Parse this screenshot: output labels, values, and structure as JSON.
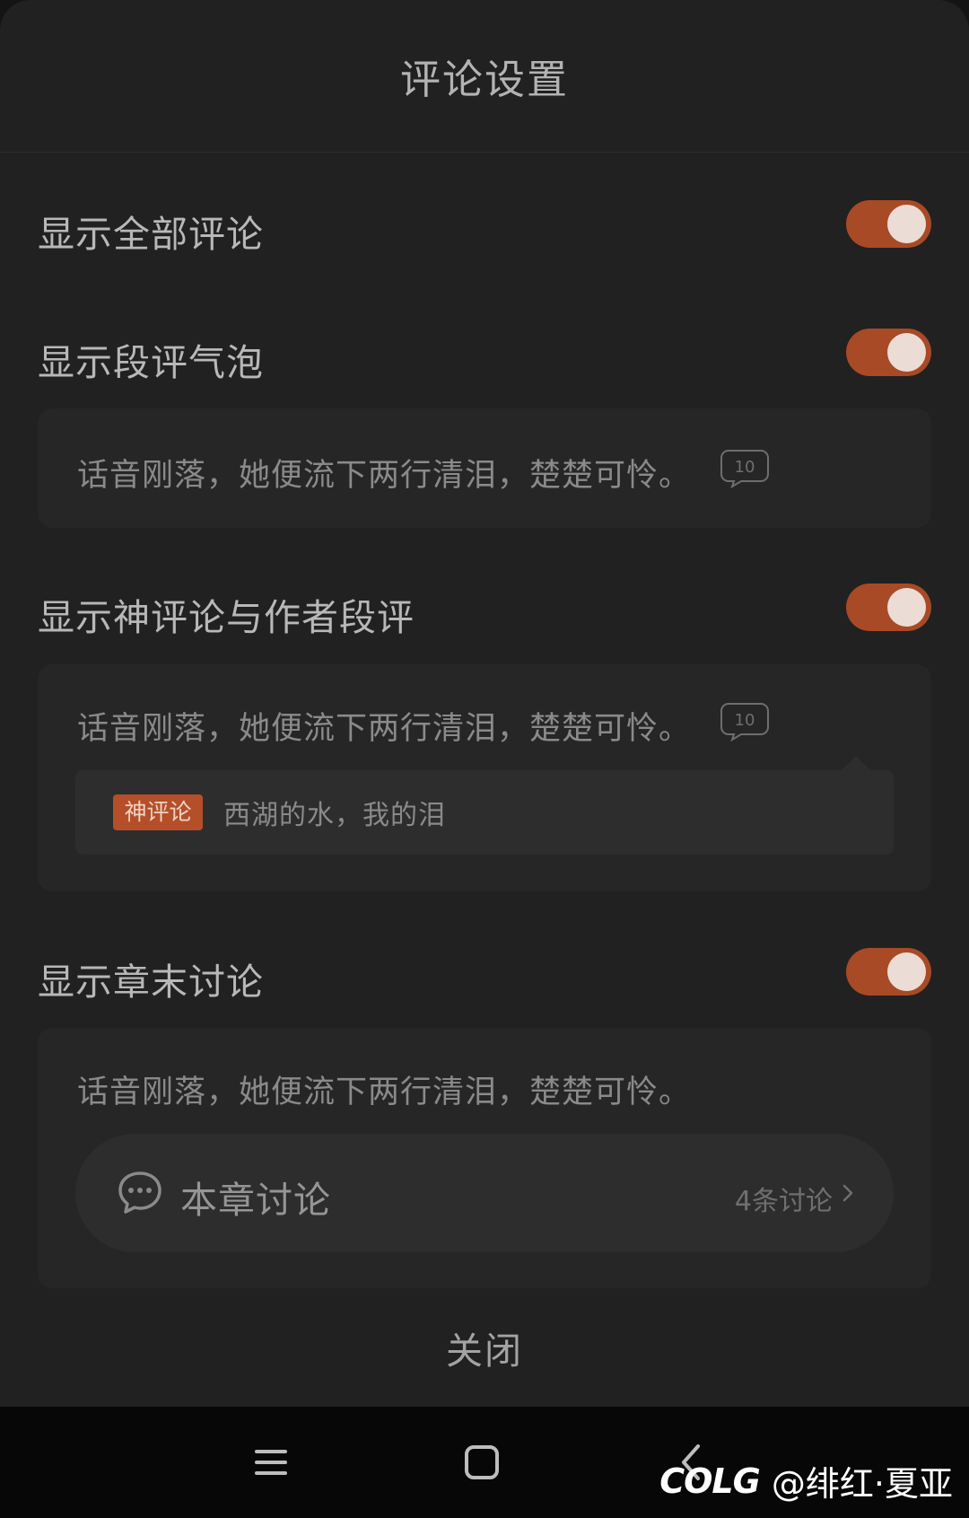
{
  "sheet": {
    "title": "评论设置",
    "close_label": "关闭"
  },
  "settings": [
    {
      "label": "显示全部评论",
      "enabled": true
    },
    {
      "label": "显示段评气泡",
      "enabled": true
    },
    {
      "label": "显示神评论与作者段评",
      "enabled": true
    },
    {
      "label": "显示章末讨论",
      "enabled": true
    }
  ],
  "previews": {
    "sample_sentence": "话音刚落，她便流下两行清泪，楚楚可怜。",
    "bubble_count": "10",
    "god_comment_tag": "神评论",
    "god_comment_text": "西湖的水，我的泪",
    "chapter_discussion_label": "本章讨论",
    "chapter_discussion_count": "4条讨论"
  },
  "colors": {
    "toggle_on": "#a84a26",
    "tag_background": "#b44f2a",
    "sheet_background": "#212121"
  },
  "icons": {
    "bubble": "comment-bubble-icon",
    "discussion": "chat-bubble-icon",
    "chevron": "chevron-right-icon",
    "nav_menu": "menu-icon",
    "nav_home": "home-square-icon",
    "nav_back": "back-chevron-icon"
  },
  "watermark": {
    "logo": "COLG",
    "text": "@绯红·夏亚"
  }
}
